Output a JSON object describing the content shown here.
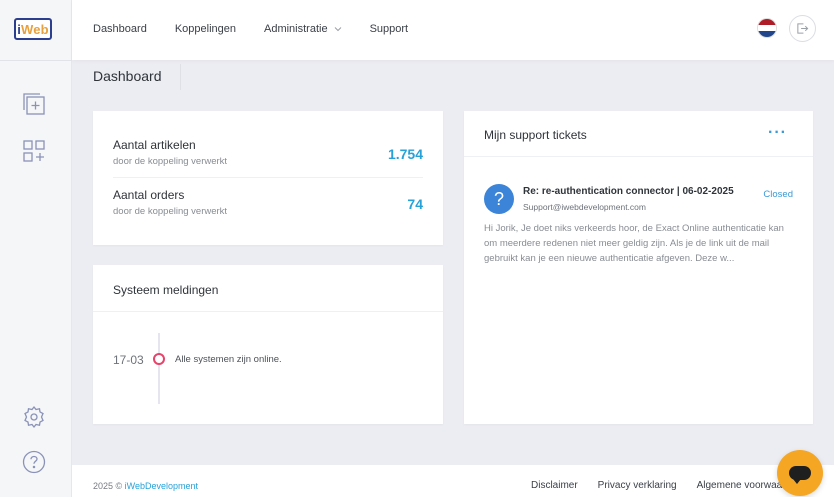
{
  "brand": {
    "logo_text_a": "i",
    "logo_text_b": "Web"
  },
  "nav": {
    "items": [
      "Dashboard",
      "Koppelingen",
      "Administratie",
      "Support"
    ]
  },
  "page": {
    "title": "Dashboard"
  },
  "stats": [
    {
      "label": "Aantal artikelen",
      "sub": "door de koppeling verwerkt",
      "value": "1.754"
    },
    {
      "label": "Aantal orders",
      "sub": "door de koppeling verwerkt",
      "value": "74"
    }
  ],
  "system": {
    "title": "Systeem meldingen",
    "date": "17-03",
    "message": "Alle systemen zijn online."
  },
  "tickets": {
    "title": "Mijn support tickets",
    "menu": "···",
    "item": {
      "subject": "Re: re-authentication connector | 06-02-2025",
      "email": "Support@iwebdevelopment.com",
      "status": "Closed",
      "preview": "Hi Jorik, Je doet niks verkeerds hoor, de Exact Online authenticatie kan om meerdere redenen niet meer geldig zijn. Als je de link uit de mail gebruikt kan je een nieuwe authenticatie afgeven. Deze w..."
    }
  },
  "footer": {
    "year": "2025 ©",
    "company": "iWebDevelopment",
    "links": [
      "Disclaimer",
      "Privacy verklaring",
      "Algemene voorwaarden"
    ]
  },
  "colors": {
    "accent": "#27a2d8",
    "status_closed": "#3b9ad6",
    "timeline_dot": "#e8436a",
    "chat_button": "#f5a623"
  }
}
